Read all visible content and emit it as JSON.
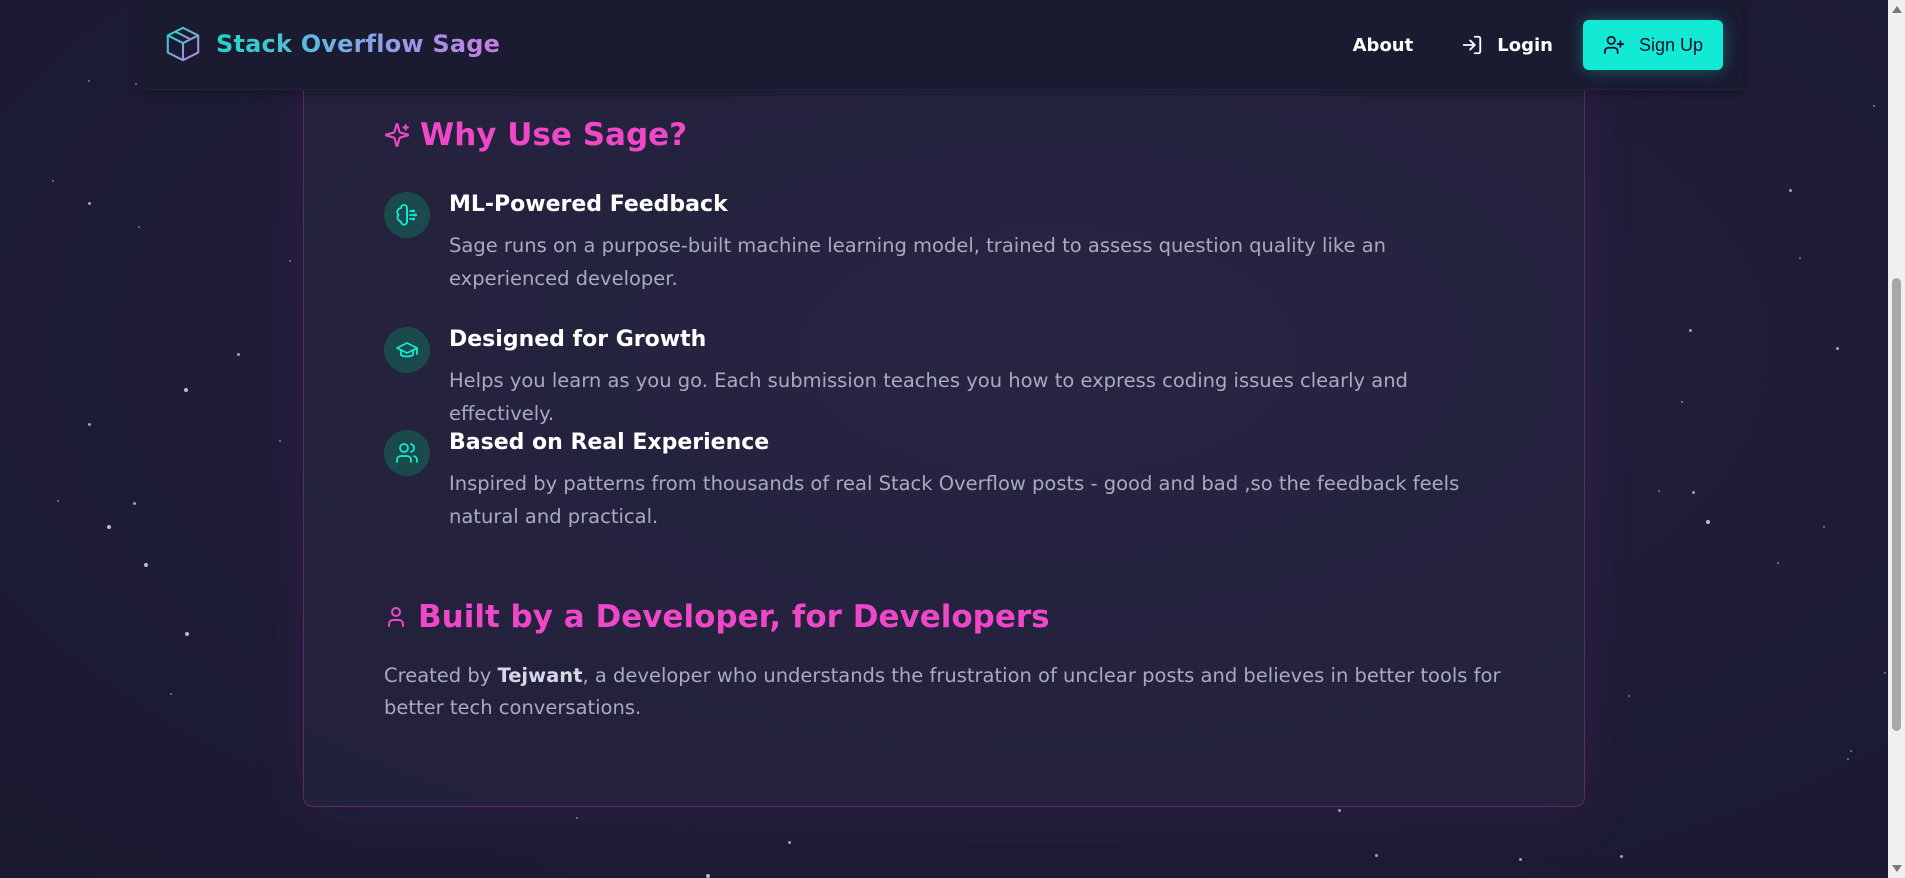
{
  "header": {
    "brand_name": "Stack Overflow Sage",
    "brand_icon": "cube-icon",
    "nav": {
      "about": "About",
      "login": "Login",
      "signup": "Sign Up"
    }
  },
  "why_section": {
    "title": "Why Use Sage?",
    "icon": "sparkles-icon",
    "features": [
      {
        "icon": "brain-icon",
        "title": "ML-Powered Feedback",
        "description": "Sage runs on a purpose-built machine learning model, trained to assess question quality like an experienced developer."
      },
      {
        "icon": "graduation-cap-icon",
        "title": "Designed for Growth",
        "description": "Helps you learn as you go. Each submission teaches you how to express coding issues clearly and effectively."
      },
      {
        "icon": "users-icon",
        "title": "Based on Real Experience",
        "description": "Inspired by patterns from thousands of real Stack Overflow posts - good and bad ,so the feedback feels natural and practical."
      }
    ]
  },
  "built_section": {
    "title": "Built by a Developer, for Developers",
    "icon": "user-icon",
    "text_before": "Created by ",
    "author": "Tejwant",
    "text_after": ", a developer who understands the frustration of unclear posts and believes in better tools for better tech conversations."
  },
  "colors": {
    "accent_pink": "#ee48c8",
    "accent_cyan": "#13ead6",
    "background": "#1b1a33"
  }
}
